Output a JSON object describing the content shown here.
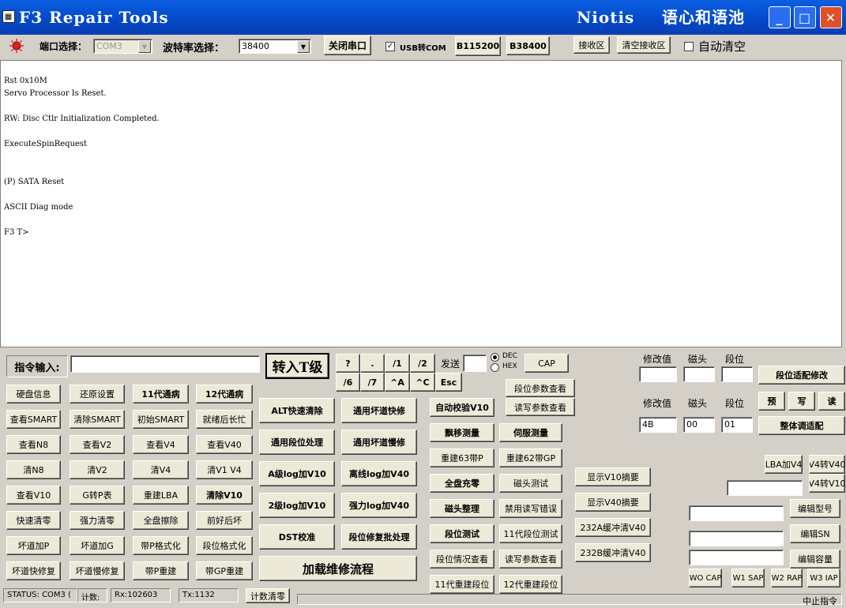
{
  "window": {
    "title": "F3 Repair Tools",
    "author": "Niotis",
    "brand": "语心和语池",
    "controls": {
      "minimize": "_",
      "maximize": "□",
      "close": "✕"
    }
  },
  "toolbar": {
    "port_label": "端口选择：",
    "port_value": "COM3",
    "baud_label": "波特率选择：",
    "baud_value": "38400",
    "close_port": "关闭串口",
    "usb_com_label": "USB转COM",
    "usb_com_checked": "✓",
    "b115200": "B115200",
    "b38400": "B38400",
    "receive_area": "接收区",
    "clear_receive": "清空接收区",
    "auto_clear_label": "自动清空"
  },
  "console": {
    "lines": [
      "Rst 0x10M",
      "Servo Processor Is Reset.",
      "",
      "RW: Disc Ctlr Initialization Completed.",
      "",
      "ExecuteSpinRequest",
      "",
      "",
      "(P) SATA Reset",
      "",
      "ASCII Diag mode",
      "",
      "F3 T>"
    ]
  },
  "command": {
    "label": "指令输入:",
    "value": "",
    "to_t_level": "转入T级",
    "keys_row1": [
      "?",
      ".",
      "/1",
      "/2"
    ],
    "keys_row2": [
      "/6",
      "/7",
      "^A",
      "^C",
      "Esc"
    ],
    "send_label": "发送",
    "send_value": "",
    "dec_label": "DEC",
    "hex_label": "HEX",
    "cap": "CAP"
  },
  "left_grid": [
    [
      "硬盘信息",
      "还原设置",
      "11代通病",
      "12代通病"
    ],
    [
      "查看SMART",
      "清除SMART",
      "初始SMART",
      "就绪后长忙"
    ],
    [
      "查看N8",
      "查看V2",
      "查看V4",
      "查看V40"
    ],
    [
      "清N8",
      "清V2",
      "清V4",
      "清V1 V4"
    ],
    [
      "查看V10",
      "G转P表",
      "重建LBA",
      "清除V10"
    ],
    [
      "快速清零",
      "强力清零",
      "全盘擦除",
      "前好后坏"
    ],
    [
      "坏道加P",
      "坏道加G",
      "带P格式化",
      "段位格式化"
    ],
    [
      "坏道快修复",
      "坏道慢修复",
      "带P重建",
      "带GP重建"
    ]
  ],
  "mid_grid": [
    [
      "ALT快速清除",
      "通用坏道快修"
    ],
    [
      "通用段位处理",
      "通用坏道慢修"
    ],
    [
      "A级log加V10",
      "离线log加V40"
    ],
    [
      "2级log加V10",
      "强力log加V40"
    ],
    [
      "DST校准",
      "段位修复批处理"
    ]
  ],
  "load_flow": "加载维修流程",
  "right_grid": [
    [
      "自动校验V10",
      ""
    ],
    [
      "飘移测量",
      "伺服测量"
    ],
    [
      "重建63带P",
      "重建62带GP"
    ],
    [
      "全盘充零",
      "磁头测试"
    ],
    [
      "磁头整理",
      "禁用读写错误"
    ],
    [
      "段位测试",
      "11代段位测试"
    ],
    [
      "段位情况查看",
      "读写参数查看"
    ],
    [
      "11代重建段位",
      "12代重建段位"
    ]
  ],
  "param_buttons": [
    "段位参数查看",
    "读写参数查看"
  ],
  "summary_buttons": [
    "显示V10摘要",
    "显示V40摘要",
    "232A缓冲清V40",
    "232B缓冲清V40"
  ],
  "segment": {
    "modify_label": "修改值",
    "head_label": "磁头",
    "seg_label": "段位",
    "row1": {
      "modify": "",
      "head": "",
      "seg": ""
    },
    "row2": {
      "modify": "4B",
      "head": "00",
      "seg": "01"
    },
    "adapt_modify": "段位适配修改",
    "pre": "预",
    "write": "写",
    "read": "读",
    "overall_adapt": "整体调适配"
  },
  "lba": {
    "lba_to_v4": "LBA加V4",
    "v4_to_v40": "V4转V40",
    "v4_to_v10": "V4转V10",
    "value": ""
  },
  "edit": {
    "model": "编辑型号",
    "sn": "编辑SN",
    "capacity": "编辑容量"
  },
  "caps": [
    "WO CAP",
    "W1 SAP",
    "W2 RAP",
    "W3 IAP"
  ],
  "status": {
    "status": "STATUS: COM3 (",
    "count": "计数:",
    "rx": "Rx:102603",
    "tx": "Tx:1132",
    "clear_count": "计数清零",
    "stop": "中止指令"
  },
  "colors": {
    "title_bar": "#0349c9",
    "console_bg": "#ffffff",
    "face": "#d4d0c8"
  }
}
